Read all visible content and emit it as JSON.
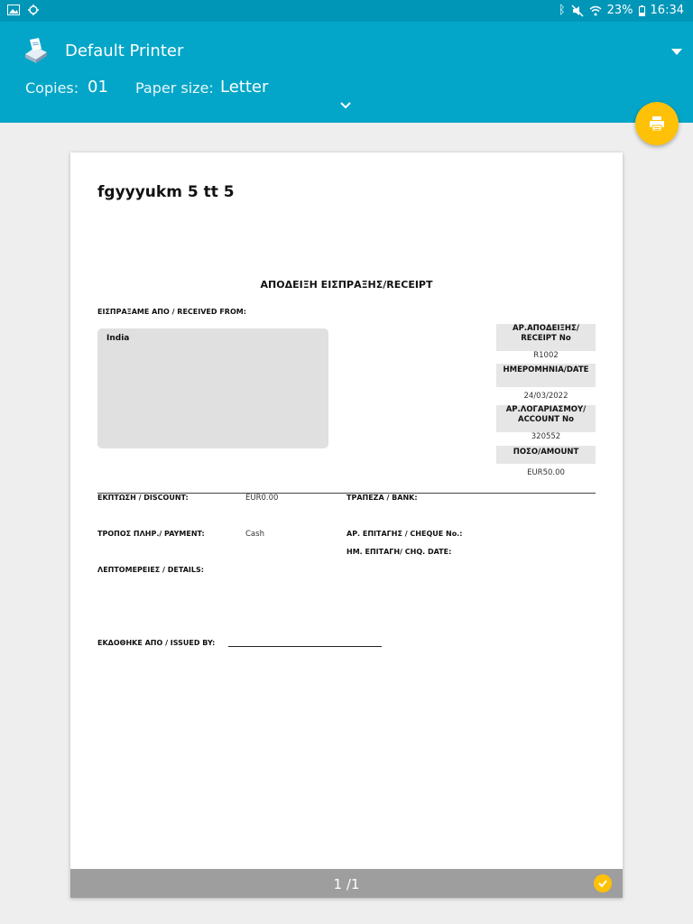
{
  "status": {
    "battery": "23%",
    "time": "16:34"
  },
  "header": {
    "printer_name": "Default Printer",
    "copies_label": "Copies:",
    "copies_value": "01",
    "paper_label": "Paper size:",
    "paper_value": "Letter",
    "accent": "#03a6c8",
    "fab_color": "#ffc107"
  },
  "document": {
    "title": "fgyyyukm 5 tt 5",
    "receipt_heading": "ΑΠΟΔΕΙΞΗ ΕΙΣΠΡΑΞΗΣ/RECEIPT",
    "received_from_label": "ΕΙΣΠΡΑΞΑΜΕ ΑΠΟ / RECEIVED FROM:",
    "received_from_value": "India",
    "receipt_no_label": "ΑΡ.ΑΠΟΔΕΙΞΗΣ/ RECEIPT No",
    "receipt_no_value": "R1002",
    "date_label": "ΗΜΕΡΟΜΗΝΙΑ/DATE",
    "date_value": "24/03/2022",
    "account_label": "ΑΡ.ΛΟΓΑΡΙΑΣΜΟΥ/ ACCOUNT No",
    "account_value": "320552",
    "amount_label": "ΠΟΣΟ/AMOUNT",
    "amount_value": "EUR50.00",
    "discount_label": "ΕΚΠΤΩΣΗ / DISCOUNT:",
    "discount_value": "EUR0.00",
    "bank_label": "ΤΡΑΠΕΖΑ / BANK:",
    "payment_label": "ΤΡΟΠΟΣ ΠΛΗΡ./ PAYMENT:",
    "payment_value": "Cash",
    "cheque_no_label": "ΑΡ. ΕΠΙΤΑΓΗΣ / CHEQUE No.:",
    "cheque_date_label": "ΗΜ. ΕΠΙΤΑΓΗ/ CHQ. DATE:",
    "details_label": "ΛΕΠΤΟΜΕΡΕΙΕΣ / DETAILS:",
    "issued_by_label": "ΕΚΔΟΘΗΚΕ ΑΠΟ / ISSUED BY:"
  },
  "footer": {
    "page_indicator": "1 /1"
  }
}
